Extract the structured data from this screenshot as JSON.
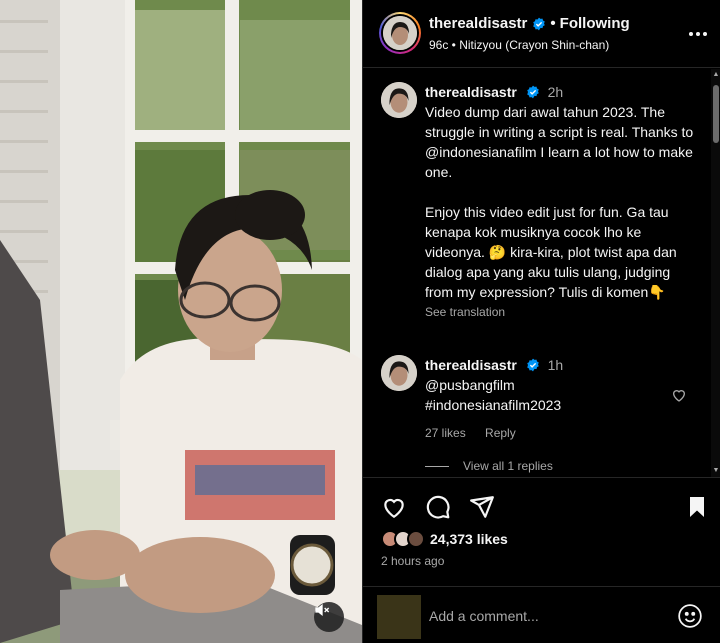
{
  "header": {
    "username": "therealdisastr",
    "separator": "•",
    "follow_label": "Following",
    "audio": "96c • Nitizyou (Crayon Shin-chan)"
  },
  "caption": {
    "username": "therealdisastr",
    "time": "2h",
    "text": "Video dump dari awal tahun 2023. The struggle in writing a script is real. Thanks to @indonesianafilm I learn a lot how to make one.\n\nEnjoy this video edit just for fun. Ga tau kenapa kok musiknya cocok lho ke videonya. 🤔 kira-kira, plot twist apa dan dialog apa yang aku tulis ulang, judging from my expression? Tulis di komen👇",
    "see_translation": "See translation"
  },
  "comment": {
    "username": "therealdisastr",
    "time": "1h",
    "line1": "@pusbangfilm",
    "line2": "#indonesianafilm2023",
    "likes": "27 likes",
    "reply": "Reply",
    "view_replies": "View all 1 replies"
  },
  "post": {
    "likes": "24,373 likes",
    "time": "2 hours ago"
  },
  "add_comment": {
    "placeholder": "Add a comment..."
  },
  "icons": {
    "verified": "verified-badge-icon",
    "more": "more-horizontal-icon",
    "like": "heart-icon",
    "comment": "comment-bubble-icon",
    "share": "paper-plane-icon",
    "save": "bookmark-icon",
    "emoji": "smiley-icon",
    "mute": "speaker-muted-icon"
  },
  "colors": {
    "background": "#000000",
    "text": "#f5f5f5",
    "secondary": "#a8a8a8",
    "verified": "#0095f6",
    "divider": "#262626"
  }
}
